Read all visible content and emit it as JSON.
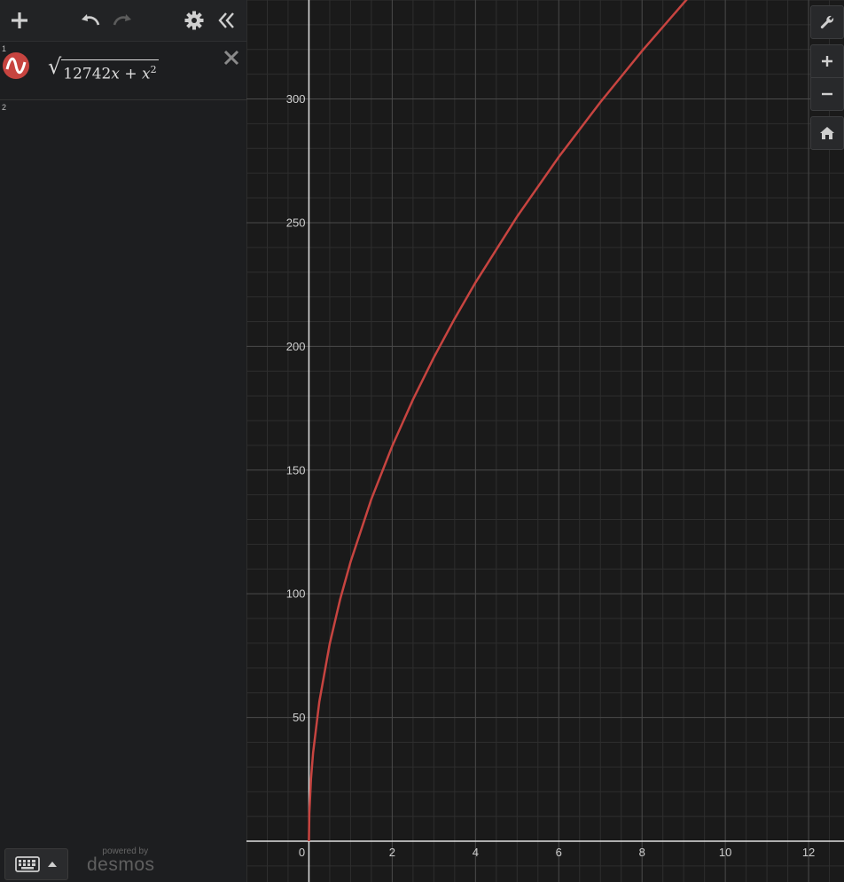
{
  "app": {
    "name": "desmos",
    "powered_by": "powered by"
  },
  "expressions": [
    {
      "index": "1",
      "latex_parts": {
        "coef": "12742",
        "var": "x",
        "plus": " + ",
        "var2": "x",
        "exp": "2"
      },
      "color": "#c74440"
    },
    {
      "index": "2"
    }
  ],
  "chart_data": {
    "type": "line",
    "title": "",
    "xlabel": "",
    "ylabel": "",
    "xlim": [
      -1.5,
      12.85
    ],
    "ylim": [
      -16.5,
      340
    ],
    "x_ticks": [
      "0",
      "2",
      "4",
      "6",
      "8",
      "10",
      "12"
    ],
    "y_ticks": [
      "50",
      "100",
      "150",
      "200",
      "250",
      "300"
    ],
    "grid": true,
    "series": [
      {
        "color": "#c74440",
        "x": [
          0,
          0.01,
          0.05,
          0.1,
          0.25,
          0.5,
          0.75,
          1,
          1.5,
          2,
          2.5,
          3,
          3.5,
          4,
          5,
          6,
          7,
          8,
          9,
          9.2
        ],
        "y": [
          0,
          11.29,
          25.24,
          35.7,
          56.44,
          79.82,
          97.76,
          112.88,
          138.27,
          159.67,
          178.53,
          195.54,
          211.21,
          225.8,
          252.46,
          276.56,
          298.72,
          319.38,
          338.8,
          342.6
        ]
      }
    ]
  },
  "colors": {
    "graph_bg": "#1a1a1a",
    "curve": "#c74440",
    "grid_major": "#4a4a4a",
    "grid_minor": "#2e2e2e",
    "axis": "#e0e0e0"
  }
}
